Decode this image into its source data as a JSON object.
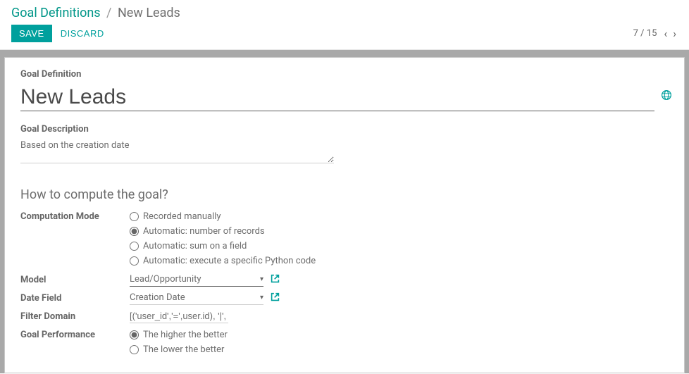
{
  "breadcrumb": {
    "parent": "Goal Definitions",
    "current": "New Leads"
  },
  "buttons": {
    "save": "SAVE",
    "discard": "DISCARD"
  },
  "pager": {
    "text": "7 / 15"
  },
  "goal_definition_label": "Goal Definition",
  "goal_name": "New Leads",
  "goal_description_label": "Goal Description",
  "goal_description": "Based on the creation date",
  "compute_section_title": "How to compute the goal?",
  "computation_mode": {
    "label": "Computation Mode",
    "options": [
      {
        "label": "Recorded manually",
        "checked": false
      },
      {
        "label": "Automatic: number of records",
        "checked": true
      },
      {
        "label": "Automatic: sum on a field",
        "checked": false
      },
      {
        "label": "Automatic: execute a specific Python code",
        "checked": false
      }
    ]
  },
  "model": {
    "label": "Model",
    "value": "Lead/Opportunity"
  },
  "date_field": {
    "label": "Date Field",
    "value": "Creation Date"
  },
  "filter_domain": {
    "label": "Filter Domain",
    "value": "[('user_id','=',user.id), '|', ('t"
  },
  "goal_performance": {
    "label": "Goal Performance",
    "options": [
      {
        "label": "The higher the better",
        "checked": true
      },
      {
        "label": "The lower the better",
        "checked": false
      }
    ]
  }
}
